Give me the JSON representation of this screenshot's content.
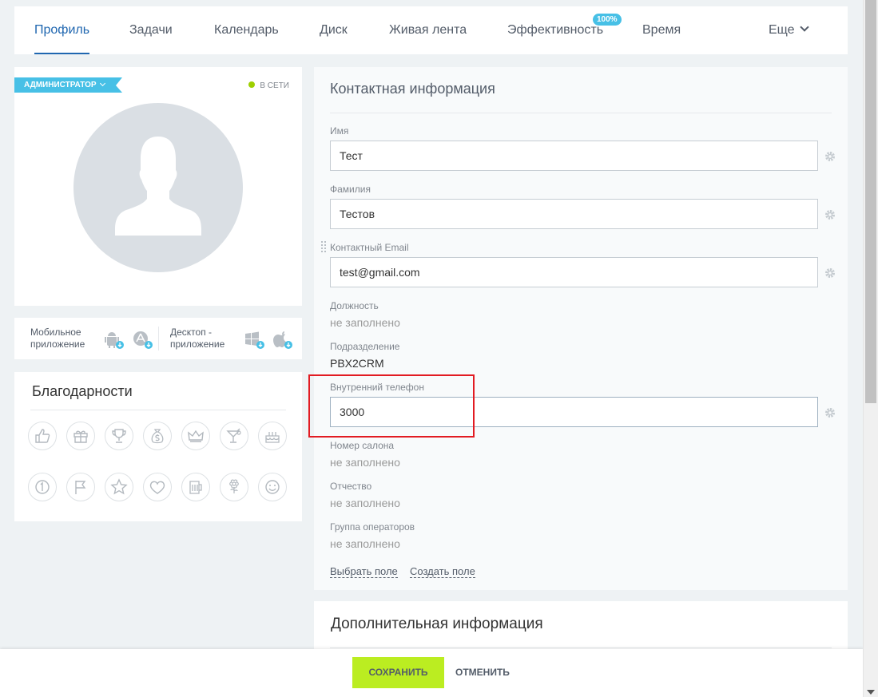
{
  "nav": {
    "tabs": [
      {
        "label": "Профиль"
      },
      {
        "label": "Задачи"
      },
      {
        "label": "Календарь"
      },
      {
        "label": "Диск"
      },
      {
        "label": "Живая лента"
      },
      {
        "label": "Эффективность"
      },
      {
        "label": "Время"
      }
    ],
    "efficiency_badge": "100%",
    "more_label": "Еще"
  },
  "profile": {
    "role_badge": "АДМИНИСТРАТОР",
    "status": "В СЕТИ",
    "status_color": "#9dcf00"
  },
  "apps": {
    "mobile_line1": "Мобильное",
    "mobile_line2": "приложение",
    "desktop_line1": "Десктоп -",
    "desktop_line2": "приложение"
  },
  "thanks": {
    "title": "Благодарности",
    "icons": [
      "thumbs-up-icon",
      "gift-icon",
      "trophy-icon",
      "money-bag-icon",
      "crown-icon",
      "cocktail-icon",
      "cake-icon",
      "number-one-icon",
      "flag-icon",
      "star-icon",
      "heart-icon",
      "beer-icon",
      "flower-icon",
      "smile-icon"
    ]
  },
  "contact": {
    "title": "Контактная информация",
    "name_label": "Имя",
    "name_value": "Тест",
    "surname_label": "Фамилия",
    "surname_value": "Тестов",
    "email_label": "Контактный Email",
    "email_value": "test@gmail.com",
    "position_label": "Должность",
    "position_value": "не заполнено",
    "department_label": "Подразделение",
    "department_value": "PBX2CRM",
    "phone_label": "Внутренний телефон",
    "phone_value": "3000",
    "salon_label": "Номер салона",
    "salon_value": "не заполнено",
    "patronymic_label": "Отчество",
    "patronymic_value": "не заполнено",
    "operators_label": "Группа операторов",
    "operators_value": "не заполнено",
    "select_field_link": "Выбрать поле",
    "create_field_link": "Создать поле"
  },
  "extra": {
    "title": "Дополнительная информация"
  },
  "footer": {
    "save_label": "СОХРАНИТЬ",
    "cancel_label": "ОТМЕНИТЬ"
  },
  "colors": {
    "accent": "#2067b0",
    "badge": "#47c0e6",
    "save": "#bbed21",
    "highlight": "#e21b22"
  }
}
